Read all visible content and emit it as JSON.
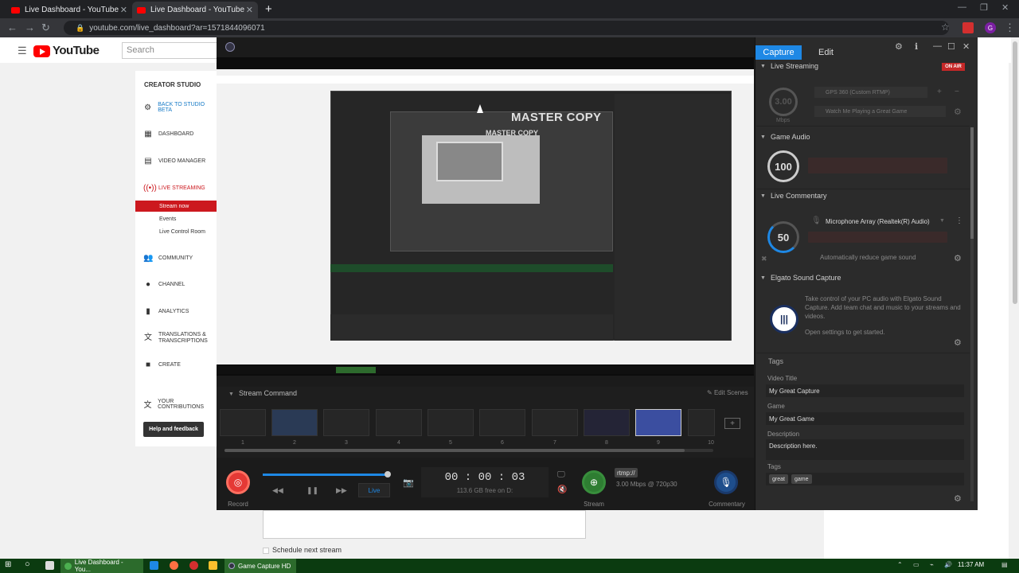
{
  "browser": {
    "tabs": [
      {
        "label": "Live Dashboard - YouTube"
      },
      {
        "label": "Live Dashboard - YouTube"
      }
    ],
    "url": "youtube.com/live_dashboard?ar=1571844096071",
    "profile_initial": "G"
  },
  "youtube": {
    "logo_text": "YouTube",
    "search_placeholder": "Search",
    "studio_title": "CREATOR STUDIO",
    "nav": [
      {
        "label": "BACK TO STUDIO BETA",
        "icon": "gear-icon"
      },
      {
        "label": "DASHBOARD",
        "icon": "dashboard-icon"
      },
      {
        "label": "VIDEO MANAGER",
        "icon": "video-manager-icon"
      },
      {
        "label": "LIVE STREAMING",
        "icon": "live-icon"
      },
      {
        "label": "COMMUNITY",
        "icon": "community-icon"
      },
      {
        "label": "CHANNEL",
        "icon": "channel-icon"
      },
      {
        "label": "ANALYTICS",
        "icon": "analytics-icon"
      },
      {
        "label": "TRANSLATIONS & TRANSCRIPTIONS",
        "icon": "translate-icon"
      },
      {
        "label": "CREATE",
        "icon": "create-icon"
      },
      {
        "label": "YOUR CONTRIBUTIONS",
        "icon": "contributions-icon"
      }
    ],
    "live_sub": [
      "Stream now",
      "Events",
      "Live Control Room"
    ],
    "help_button": "Help and feedback",
    "schedule_label": "Schedule next stream"
  },
  "capture_app": {
    "preview_overlay": "MASTER COPY",
    "tabs": {
      "capture": "Capture",
      "edit": "Edit"
    },
    "sections": {
      "live_streaming": "Live Streaming",
      "game_audio": "Game Audio",
      "live_commentary": "Live Commentary",
      "sound_capture": "Elgato Sound Capture",
      "tags": "Tags"
    },
    "on_air": "ON AIR",
    "bitrate": "3.00",
    "bitrate_unit": "Mbps",
    "server_field": "GPS 360 (Custom RTMP)",
    "title_field": "Watch Me Playing a Great Game",
    "game_audio_level": "100",
    "commentary_level": "50",
    "mic_device": "Microphone Array (Realtek(R) Audio)",
    "auto_reduce": "Automatically reduce game sound",
    "sound_capture_text": "Take control of your PC audio with Elgato Sound Capture. Add team chat and music to your streams and videos.",
    "sound_capture_link": "Open settings to get started.",
    "video_title_label": "Video Title",
    "video_title": "My Great Capture",
    "game_label": "Game",
    "game": "My Great Game",
    "description_label": "Description",
    "description": "Description here.",
    "tags_label": "Tags",
    "tags": [
      "great",
      "game"
    ],
    "stream_command": "Stream Command",
    "edit_scenes": "Edit Scenes",
    "scenes": [
      "1",
      "2",
      "3",
      "4",
      "5",
      "6",
      "7",
      "8",
      "9",
      "10"
    ],
    "record_label": "Record",
    "live_label": "Live",
    "timer": "00 : 00 : 03",
    "free_space": "113.6 GB free on D:",
    "rtmp": "rtmp://",
    "stream_info": "3.00 Mbps @ 720p30",
    "stream_label": "Stream",
    "commentary_label": "Commentary"
  },
  "taskbar": {
    "items": [
      {
        "label": "Live Dashboard - You..."
      },
      {
        "label": "Game Capture HD"
      }
    ],
    "time": "11:37 AM"
  },
  "colors": {
    "accent": "#1e88e5",
    "youtube_red": "#cc181e",
    "on_air": "#c62828",
    "record": "#e53935",
    "stream": "#2e7d32"
  }
}
